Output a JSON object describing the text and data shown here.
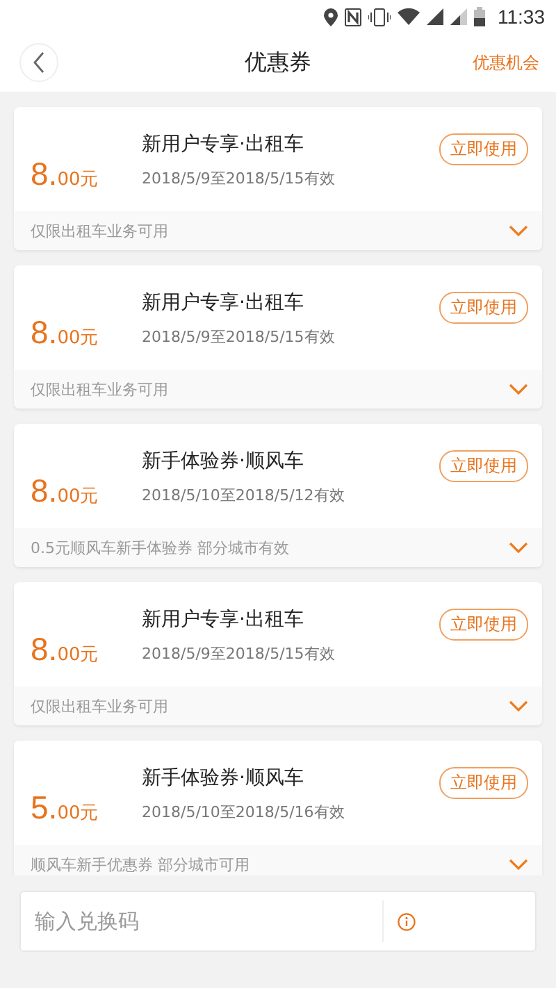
{
  "status_bar": {
    "time": "11:33"
  },
  "header": {
    "title": "优惠券",
    "action": "优惠机会"
  },
  "coupons": [
    {
      "price_main": "8.",
      "price_minor": "00元",
      "title": "新用户专享·出租车",
      "validity": "2018/5/9至2018/5/15有效",
      "button": "立即使用",
      "note": "仅限出租车业务可用"
    },
    {
      "price_main": "8.",
      "price_minor": "00元",
      "title": "新用户专享·出租车",
      "validity": "2018/5/9至2018/5/15有效",
      "button": "立即使用",
      "note": "仅限出租车业务可用"
    },
    {
      "price_main": "8.",
      "price_minor": "00元",
      "title": "新手体验券·顺风车",
      "validity": "2018/5/10至2018/5/12有效",
      "button": "立即使用",
      "note": "0.5元顺风车新手体验券 部分城市有效"
    },
    {
      "price_main": "8.",
      "price_minor": "00元",
      "title": "新用户专享·出租车",
      "validity": "2018/5/9至2018/5/15有效",
      "button": "立即使用",
      "note": "仅限出租车业务可用"
    },
    {
      "price_main": "5.",
      "price_minor": "00元",
      "title": "新手体验券·顺风车",
      "validity": "2018/5/10至2018/5/16有效",
      "button": "立即使用",
      "note": "顺风车新手优惠券 部分城市可用"
    }
  ],
  "redeem": {
    "placeholder": "输入兑换码"
  }
}
